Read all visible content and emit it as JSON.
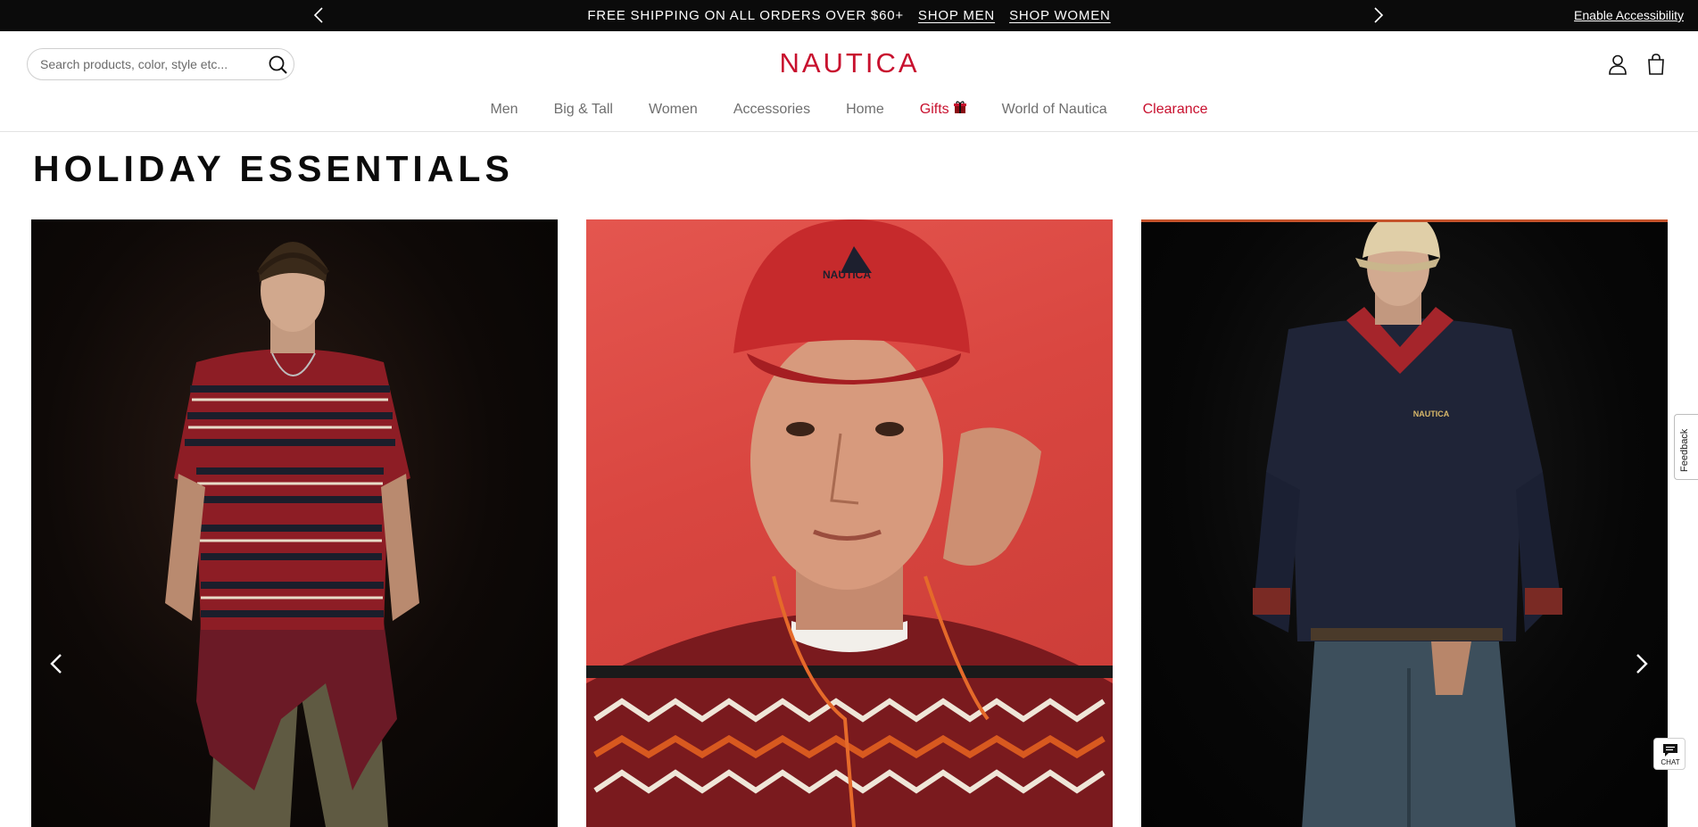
{
  "promo": {
    "message": "FREE SHIPPING ON ALL ORDERS OVER $60+",
    "links": [
      "SHOP MEN",
      "SHOP WOMEN"
    ],
    "accessibility": "Enable Accessibility"
  },
  "header": {
    "search_placeholder": "Search products, color, style etc...",
    "logo": "NAUTICA",
    "brand_color": "#c8102e",
    "icons": [
      "search-icon",
      "account-icon",
      "bag-icon"
    ]
  },
  "nav": {
    "items": [
      {
        "label": "Men"
      },
      {
        "label": "Big & Tall"
      },
      {
        "label": "Women"
      },
      {
        "label": "Accessories"
      },
      {
        "label": "Home"
      },
      {
        "label": "Gifts"
      },
      {
        "label": "World of Nautica"
      },
      {
        "label": "Clearance"
      }
    ]
  },
  "main": {
    "title": "HOLIDAY ESSENTIALS",
    "cards": [
      {
        "icon": "model-striped-tee-image"
      },
      {
        "icon": "model-red-cap-sweater-image",
        "cap_text": "NAUTICA"
      },
      {
        "icon": "model-navy-fleece-image",
        "chest_text": "NAUTICA"
      }
    ]
  },
  "widgets": {
    "feedback": "Feedback",
    "chat": "CHAT"
  }
}
